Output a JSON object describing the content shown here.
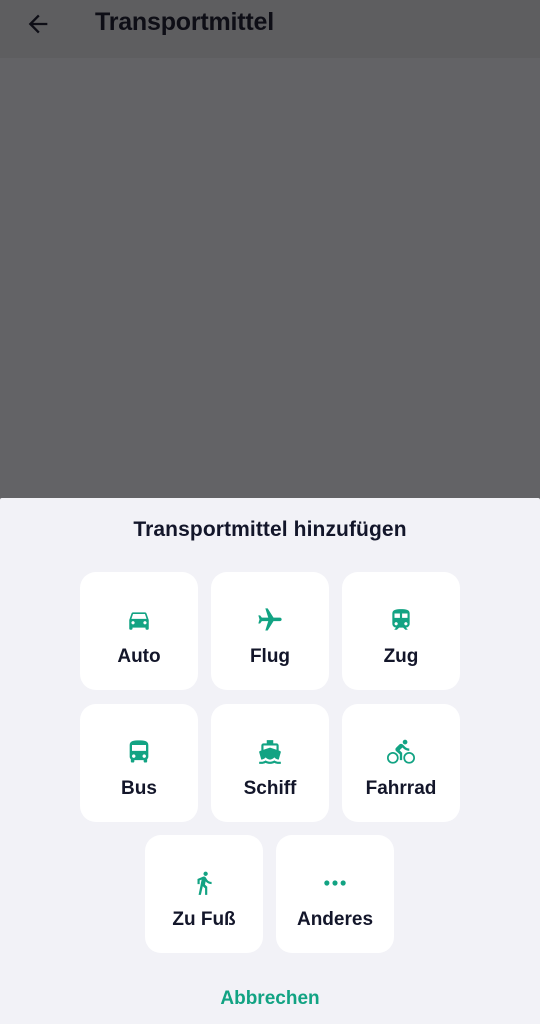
{
  "appbar": {
    "title": "Transportmittel",
    "back_icon": "arrow-left-icon"
  },
  "sheet": {
    "title": "Transportmittel hinzufügen",
    "accent_color": "#12a383",
    "options": [
      {
        "label": "Auto",
        "icon": "car-icon"
      },
      {
        "label": "Flug",
        "icon": "airplane-icon"
      },
      {
        "label": "Zug",
        "icon": "train-icon"
      },
      {
        "label": "Bus",
        "icon": "bus-icon"
      },
      {
        "label": "Schiff",
        "icon": "ship-icon"
      },
      {
        "label": "Fahrrad",
        "icon": "bicycle-icon"
      },
      {
        "label": "Zu Fuß",
        "icon": "walking-icon"
      },
      {
        "label": "Anderes",
        "icon": "more-dots-icon"
      }
    ],
    "cancel_label": "Abbrechen"
  }
}
